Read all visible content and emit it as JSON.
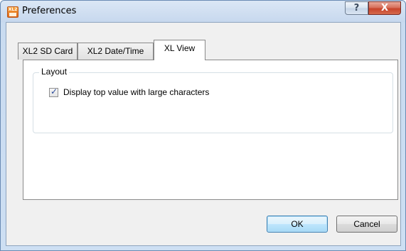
{
  "window": {
    "title": "Preferences",
    "icon_text": "XL2",
    "help_label": "?",
    "close_label": "X"
  },
  "tabs": [
    {
      "label": "XL2 SD Card",
      "active": false
    },
    {
      "label": "XL2 Date/Time",
      "active": false
    },
    {
      "label": "XL View",
      "active": true
    }
  ],
  "layout_group": {
    "title": "Layout",
    "checkbox": {
      "label": "Display top value with large characters",
      "checked": true
    }
  },
  "buttons": {
    "ok_label": "OK",
    "cancel_label": "Cancel"
  }
}
